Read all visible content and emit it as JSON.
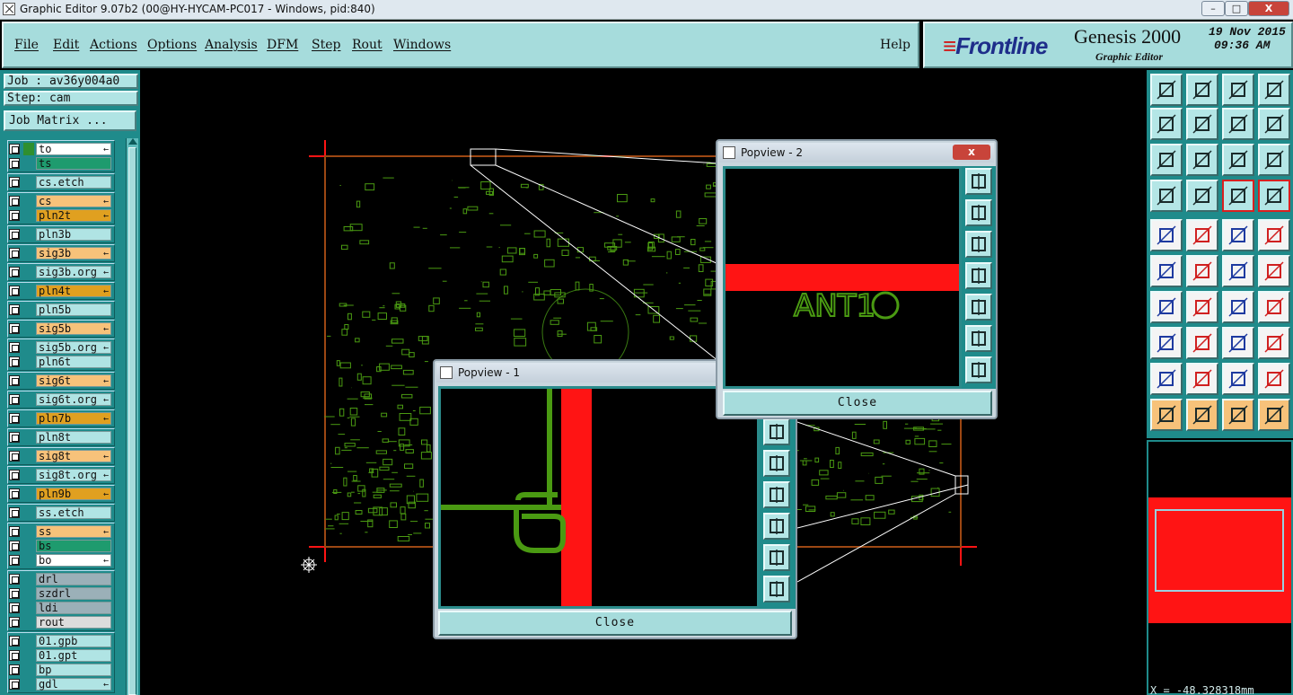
{
  "window": {
    "title": "Graphic Editor 9.07b2 (00@HY-HYCAM-PC017 - Windows, pid:840)",
    "min_label": "–",
    "max_label": "□",
    "close_label": "X"
  },
  "menu": {
    "items": [
      "File",
      "Edit",
      "Actions",
      "Options",
      "Analysis",
      "DFM",
      "Step",
      "Rout",
      "Windows"
    ],
    "help": "Help"
  },
  "brand": {
    "logo": "Frontline",
    "product": "Genesis 2000",
    "subtitle": "Graphic Editor",
    "date": "19 Nov 2015",
    "time": "09:36 AM"
  },
  "left": {
    "job": "Job : av36y004a0",
    "step": "Step: cam",
    "job_matrix": "Job Matrix ..."
  },
  "layers": [
    {
      "name": "to",
      "bg": "#ffffff",
      "swatch": "#2f8f2f",
      "mark": true
    },
    {
      "name": "ts",
      "bg": "#1e9b6e",
      "swatch": "",
      "mark": false
    },
    {
      "name": "cs.etch",
      "bg": "#b0e4e4",
      "swatch": "",
      "mark": false
    },
    {
      "name": "cs",
      "bg": "#f7c27a",
      "swatch": "",
      "mark": true
    },
    {
      "name": "pln2t",
      "bg": "#e0a020",
      "swatch": "",
      "mark": true
    },
    {
      "name": "pln3b",
      "bg": "#b0e4e4",
      "swatch": "",
      "mark": false
    },
    {
      "name": "sig3b",
      "bg": "#f7c27a",
      "swatch": "",
      "mark": true
    },
    {
      "name": "sig3b.org",
      "bg": "#b0e4e4",
      "swatch": "",
      "mark": true
    },
    {
      "name": "pln4t",
      "bg": "#e0a020",
      "swatch": "",
      "mark": true
    },
    {
      "name": "pln5b",
      "bg": "#b0e4e4",
      "swatch": "",
      "mark": false
    },
    {
      "name": "sig5b",
      "bg": "#f7c27a",
      "swatch": "",
      "mark": true
    },
    {
      "name": "sig5b.org",
      "bg": "#b0e4e4",
      "swatch": "",
      "mark": true
    },
    {
      "name": "pln6t",
      "bg": "#b0e4e4",
      "swatch": "",
      "mark": false
    },
    {
      "name": "sig6t",
      "bg": "#f7c27a",
      "swatch": "",
      "mark": true
    },
    {
      "name": "sig6t.org",
      "bg": "#b0e4e4",
      "swatch": "",
      "mark": true
    },
    {
      "name": "pln7b",
      "bg": "#e0a020",
      "swatch": "",
      "mark": true
    },
    {
      "name": "pln8t",
      "bg": "#b0e4e4",
      "swatch": "",
      "mark": false
    },
    {
      "name": "sig8t",
      "bg": "#f7c27a",
      "swatch": "",
      "mark": true
    },
    {
      "name": "sig8t.org",
      "bg": "#b0e4e4",
      "swatch": "",
      "mark": true
    },
    {
      "name": "pln9b",
      "bg": "#e0a020",
      "swatch": "",
      "mark": true
    },
    {
      "name": "ss.etch",
      "bg": "#b0e4e4",
      "swatch": "",
      "mark": false
    },
    {
      "name": "ss",
      "bg": "#f7c27a",
      "swatch": "",
      "mark": true
    },
    {
      "name": "bs",
      "bg": "#1e9b6e",
      "swatch": "",
      "mark": false
    },
    {
      "name": "bo",
      "bg": "#ffffff",
      "swatch": "",
      "mark": true
    },
    {
      "name": "drl",
      "bg": "#9bb0b8",
      "swatch": "",
      "mark": false
    },
    {
      "name": "szdrl",
      "bg": "#9bb0b8",
      "swatch": "",
      "mark": false
    },
    {
      "name": "ldi",
      "bg": "#9bb0b8",
      "swatch": "",
      "mark": false
    },
    {
      "name": "rout",
      "bg": "#dcdcdc",
      "swatch": "",
      "mark": false
    },
    {
      "name": "01.gpb",
      "bg": "#b0e4e4",
      "swatch": "",
      "mark": false
    },
    {
      "name": "01.gpt",
      "bg": "#b0e4e4",
      "swatch": "",
      "mark": false
    },
    {
      "name": "bp",
      "bg": "#b0e4e4",
      "swatch": "",
      "mark": false
    },
    {
      "name": "gdl",
      "bg": "#b0e4e4",
      "swatch": "",
      "mark": true
    }
  ],
  "popups": {
    "p1_title": "Popview - 1",
    "p2_title": "Popview - 2",
    "close_x": "x",
    "close_label": "Close",
    "p2_label": "ANT1"
  },
  "status": {
    "coord": "X = -48.328318mm"
  },
  "colors": {
    "panel": "#1f8b8b",
    "menubar": "#a6dcdc",
    "profile_red": "#ff1414",
    "trace_green": "#4a9a12"
  }
}
